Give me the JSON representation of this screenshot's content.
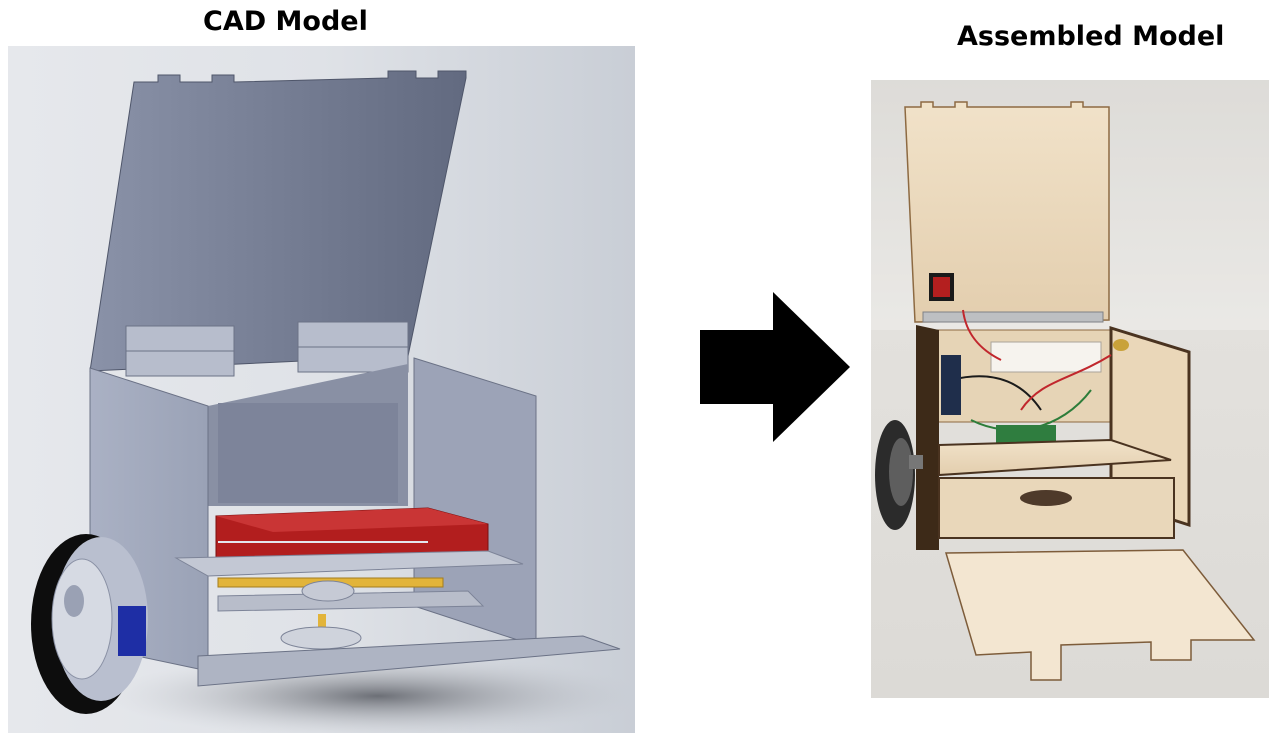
{
  "titles": {
    "cad": "CAD Model",
    "assembled": "Assembled Model"
  },
  "colors": {
    "cad_background": "#d4d8df",
    "panel_gray": "#8f97ac",
    "breadboard_red": "#b21e1e",
    "axle_yellow": "#e2b43a",
    "wheel_black": "#0d0d0d",
    "wood": "#ead6b8",
    "arrow": "#000000"
  },
  "icons": [
    "right-arrow-icon",
    "wheel-icon",
    "hinge-icon"
  ]
}
